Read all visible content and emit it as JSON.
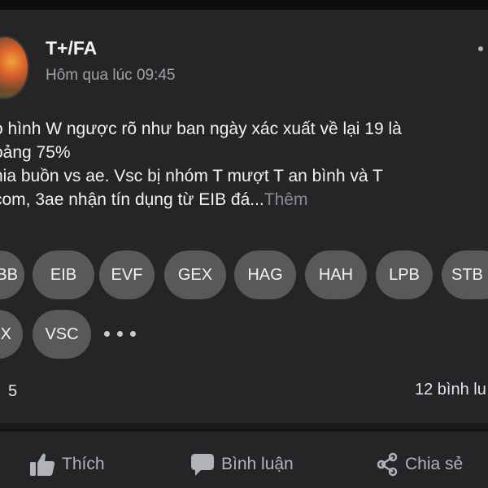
{
  "post": {
    "author": "T+/FA",
    "time": "Hôm qua lúc 09:45",
    "body_lines": [
      "o hình W ngược rõ như ban ngày xác xuất về lại 19 là",
      "oảng 75%",
      "hia buồn vs ae. Vsc bị nhóm T mượt T an bình và T",
      "com, 3ae nhận tín dụng từ EIB đá..."
    ],
    "see_more": "Thêm",
    "tags_row1": [
      "BB",
      "EIB",
      "EVF",
      "GEX",
      "HAG",
      "HAH",
      "LPB",
      "STB"
    ],
    "tags_row2": [
      "X",
      "VSC"
    ],
    "reactions": "5",
    "comments": "12 bình lu"
  },
  "actions": {
    "like": "Thích",
    "comment": "Bình luận",
    "share": "Chia sẻ"
  },
  "icons": {
    "like": "thumbs-up-icon",
    "comment": "comment-icon",
    "share": "share-icon",
    "more": "more-options-icon"
  },
  "colors": {
    "background": "#18191a",
    "card": "#252527",
    "tag": "#59595b",
    "muted": "#b0b3b8"
  }
}
